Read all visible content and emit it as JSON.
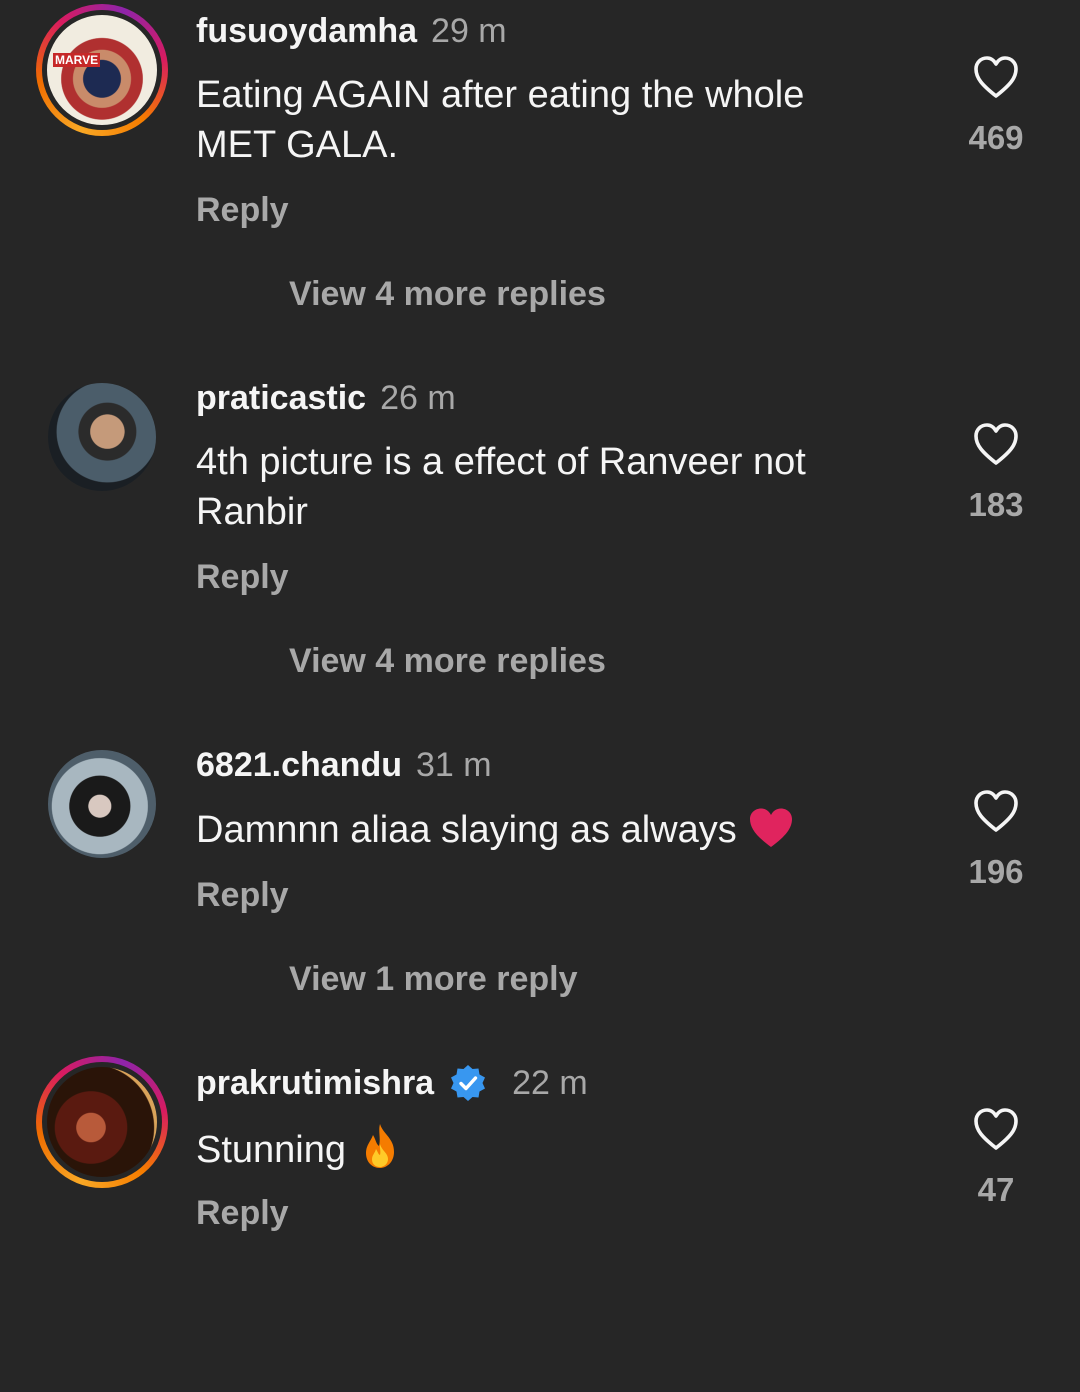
{
  "comments": [
    {
      "username": "fusuoydamha",
      "time": "29 m",
      "text": "Eating AGAIN after eating the whole MET GALA.",
      "reply_label": "Reply",
      "likes": "469",
      "more_replies": "View 4 more replies",
      "avatar_ring": true,
      "avatar_text": "MARVE"
    },
    {
      "username": "praticastic",
      "time": "26 m",
      "text": "4th picture is a effect of Ranveer not Ranbir",
      "reply_label": "Reply",
      "likes": "183",
      "more_replies": "View 4 more replies",
      "avatar_ring": false
    },
    {
      "username": "6821.chandu",
      "time": "31 m",
      "text": "Damnnn aliaa slaying as always",
      "emoji": "red-heart",
      "reply_label": "Reply",
      "likes": "196",
      "more_replies": "View 1 more reply",
      "avatar_ring": false
    },
    {
      "username": "prakrutimishra",
      "verified": true,
      "time": "22 m",
      "text": "Stunning",
      "emoji": "fire",
      "reply_label": "Reply",
      "likes": "47",
      "avatar_ring": true
    }
  ],
  "icons": {
    "like": "heart-outline-icon",
    "verified": "verified-badge-icon"
  },
  "colors": {
    "background": "#262626",
    "primary_text": "#f5f5f5",
    "secondary_text": "#a8a8a8",
    "verified_blue": "#3897f0",
    "heart_red": "#e0245e"
  }
}
